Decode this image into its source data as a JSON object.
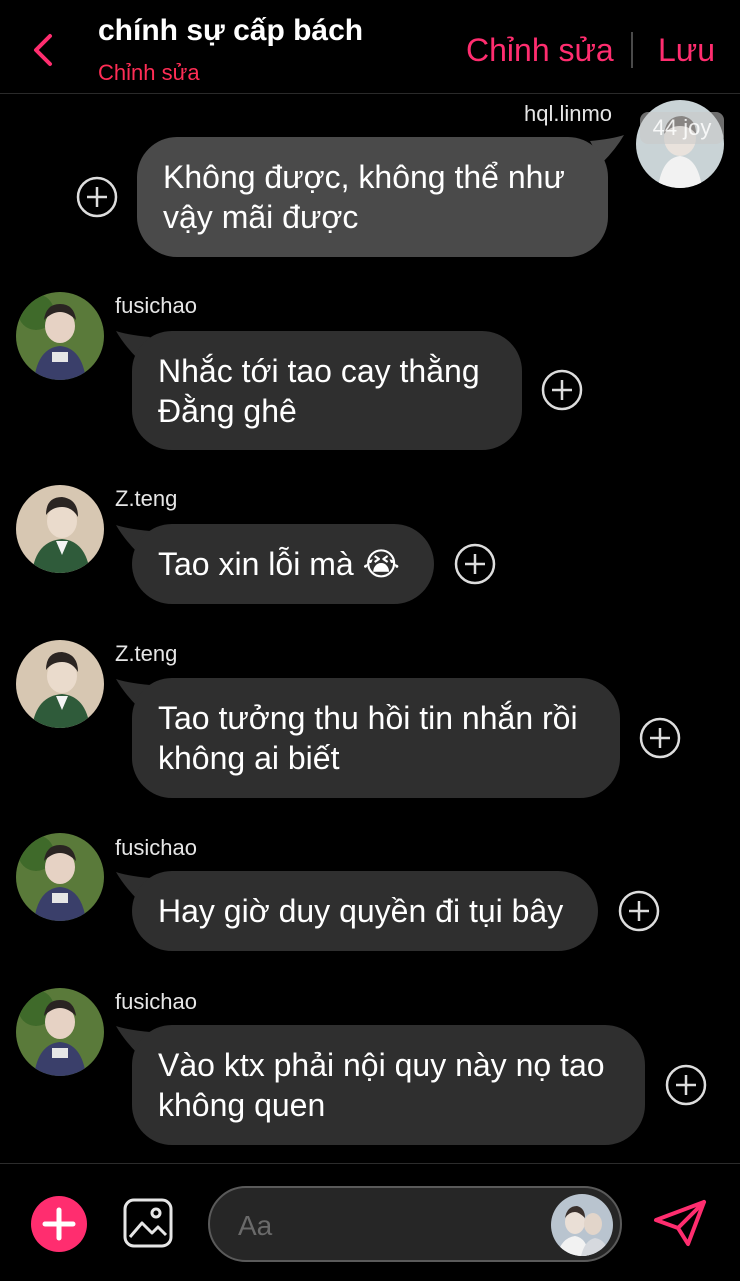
{
  "header": {
    "title": "chính sự cấp bách",
    "subtitle": "Chỉnh sửa",
    "edit_label": "Chỉnh sửa",
    "save_label": "Lưu",
    "accent": "#ff2d6f"
  },
  "messages": [
    {
      "sender": "hql.linmo",
      "text": "Không được, không thể như\nvậy mãi được",
      "direction": "outgoing",
      "badge": "44 joy"
    },
    {
      "sender": "fusichao",
      "text": "Nhắc tới tao cay thằng\nĐằng ghê",
      "direction": "incoming"
    },
    {
      "sender": "Z.teng",
      "text": "Tao xin lỗi mà 😭",
      "direction": "incoming"
    },
    {
      "sender": "Z.teng",
      "text": "Tao tưởng thu hồi tin nhắn rồi\nkhông ai biết",
      "direction": "incoming"
    },
    {
      "sender": "fusichao",
      "text": "Hay giờ duy quyền đi tụi bây",
      "direction": "incoming"
    },
    {
      "sender": "fusichao",
      "text": "Vào ktx phải nội quy này nọ tao\nkhông quen",
      "direction": "incoming"
    }
  ],
  "composer": {
    "placeholder": "Aa"
  },
  "icons": {
    "back": "chevron-left-icon",
    "add": "plus-icon",
    "gallery": "image-icon",
    "send": "send-icon",
    "message_action": "plus-circle-icon"
  }
}
